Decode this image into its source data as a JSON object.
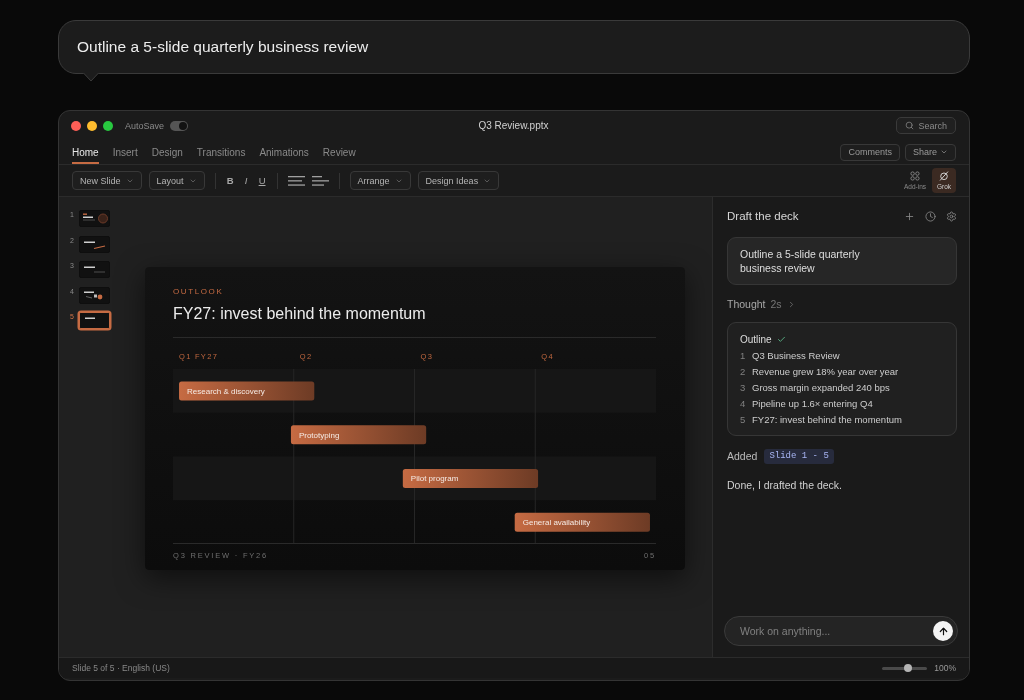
{
  "prompt_bubble": {
    "text": "Outline a 5-slide quarterly business review"
  },
  "window": {
    "title": "Q3 Review.pptx",
    "autosave": {
      "label": "AutoSave",
      "on": true
    },
    "search": {
      "label": "Search"
    }
  },
  "ribbon_tabs": [
    {
      "label": "Home",
      "selected": true
    },
    {
      "label": "Insert",
      "selected": false
    },
    {
      "label": "Design",
      "selected": false
    },
    {
      "label": "Transitions",
      "selected": false
    },
    {
      "label": "Animations",
      "selected": false
    },
    {
      "label": "Review",
      "selected": false
    }
  ],
  "header_buttons": [
    {
      "kind": "plain",
      "label": "Comments"
    },
    {
      "kind": "menu",
      "label": "Share"
    }
  ],
  "toolbar": [
    {
      "kind": "dropdown",
      "label": "New Slide"
    },
    {
      "kind": "dropdown",
      "label": "Layout"
    },
    {
      "kind": "divider"
    },
    {
      "kind": "bold",
      "label": "B"
    },
    {
      "kind": "italic",
      "label": "I"
    },
    {
      "kind": "underline",
      "label": "U"
    },
    {
      "kind": "divider"
    },
    {
      "kind": "justify"
    },
    {
      "kind": "left"
    },
    {
      "kind": "divider"
    },
    {
      "kind": "dropdown",
      "label": "Arrange"
    },
    {
      "kind": "dropdown",
      "label": "Design Ideas"
    }
  ],
  "side_tools": [
    {
      "kind": "addins",
      "label": "Add-ins",
      "selected": false
    },
    {
      "kind": "grok",
      "label": "Grok",
      "selected": true
    }
  ],
  "slides": [
    {
      "number": "1",
      "kind": "ring",
      "selected": false
    },
    {
      "number": "2",
      "kind": "trend",
      "selected": false
    },
    {
      "number": "3",
      "kind": "rule",
      "selected": false
    },
    {
      "number": "4",
      "kind": "dots",
      "selected": false
    },
    {
      "number": "5",
      "kind": "plain",
      "selected": true
    }
  ],
  "slide": {
    "eyebrow": "OUTLOOK",
    "title": "FY27: invest behind the momentum",
    "timeline": {
      "quarters": [
        "Q1 FY27",
        "Q2",
        "Q3",
        "Q4"
      ],
      "tasks": [
        "Research & discovery",
        "Prototyping",
        "Pilot program",
        "General availability"
      ]
    },
    "footer": "Q3 REVIEW · FY26",
    "page": "05"
  },
  "panel": {
    "title": "Draft the deck",
    "prompt": "Outline a 5-slide quarterly business review",
    "thought": {
      "label": "Thought",
      "duration": "2s",
      "expanded": false
    },
    "outline": {
      "title": "Outline",
      "done": true,
      "items": [
        {
          "number": "1",
          "text": "Q3 Business Review"
        },
        {
          "number": "2",
          "text": "Revenue grew 18% year over year"
        },
        {
          "number": "3",
          "text": "Gross margin expanded 240 bps"
        },
        {
          "number": "4",
          "text": "Pipeline up 1.6× entering Q4"
        },
        {
          "number": "5",
          "text": "FY27: invest behind the momentum"
        }
      ]
    },
    "added": {
      "label": "Added",
      "badge": "Slide 1 - 5"
    },
    "reply": "Done, I drafted the deck.",
    "composer": {
      "placeholder": "Work on anything..."
    }
  },
  "status_bar": {
    "text": "Slide 5 of 5 · English (US)",
    "zoom": {
      "level": 0.58,
      "reading": "100%"
    }
  }
}
